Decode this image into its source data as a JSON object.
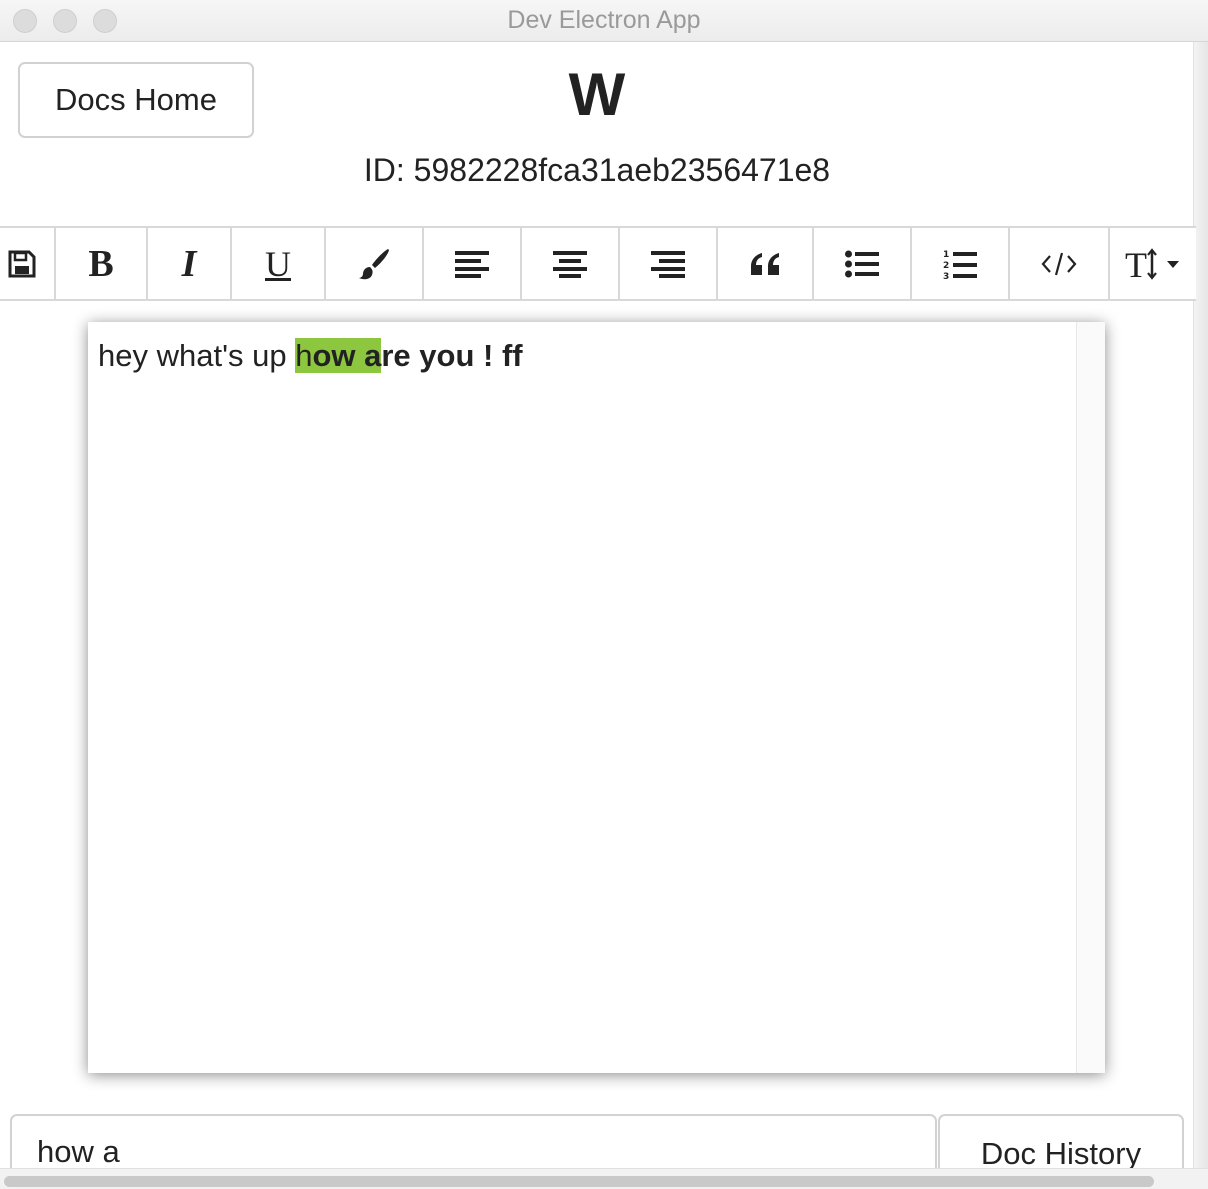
{
  "window": {
    "title": "Dev Electron App"
  },
  "header": {
    "docs_home_label": "Docs Home",
    "doc_title": "W",
    "doc_id": "ID: 5982228fca31aeb2356471e8"
  },
  "toolbar": {
    "buttons": [
      {
        "name": "save",
        "icon": "save-icon"
      },
      {
        "name": "bold",
        "icon": "bold-icon",
        "glyph": "B"
      },
      {
        "name": "italic",
        "icon": "italic-icon",
        "glyph": "I"
      },
      {
        "name": "underline",
        "icon": "underline-icon",
        "glyph": "U"
      },
      {
        "name": "color",
        "icon": "paintbrush-icon"
      },
      {
        "name": "align-left",
        "icon": "align-left-icon"
      },
      {
        "name": "align-center",
        "icon": "align-center-icon"
      },
      {
        "name": "align-right",
        "icon": "align-right-icon"
      },
      {
        "name": "quote",
        "icon": "quote-icon"
      },
      {
        "name": "bullet-list",
        "icon": "list-ul-icon"
      },
      {
        "name": "numbered-list",
        "icon": "list-ol-icon"
      },
      {
        "name": "code",
        "icon": "code-icon"
      },
      {
        "name": "font-size",
        "icon": "text-height-icon",
        "glyph": "TI"
      }
    ]
  },
  "editor": {
    "text_plain": "hey what's up ",
    "text_highlight_plain": "h",
    "text_highlight_bold": "ow a",
    "text_bold": "re you ! ff",
    "highlight_color": "#8dc63f"
  },
  "footer": {
    "search_value": "how a",
    "history_label": "Doc History"
  }
}
